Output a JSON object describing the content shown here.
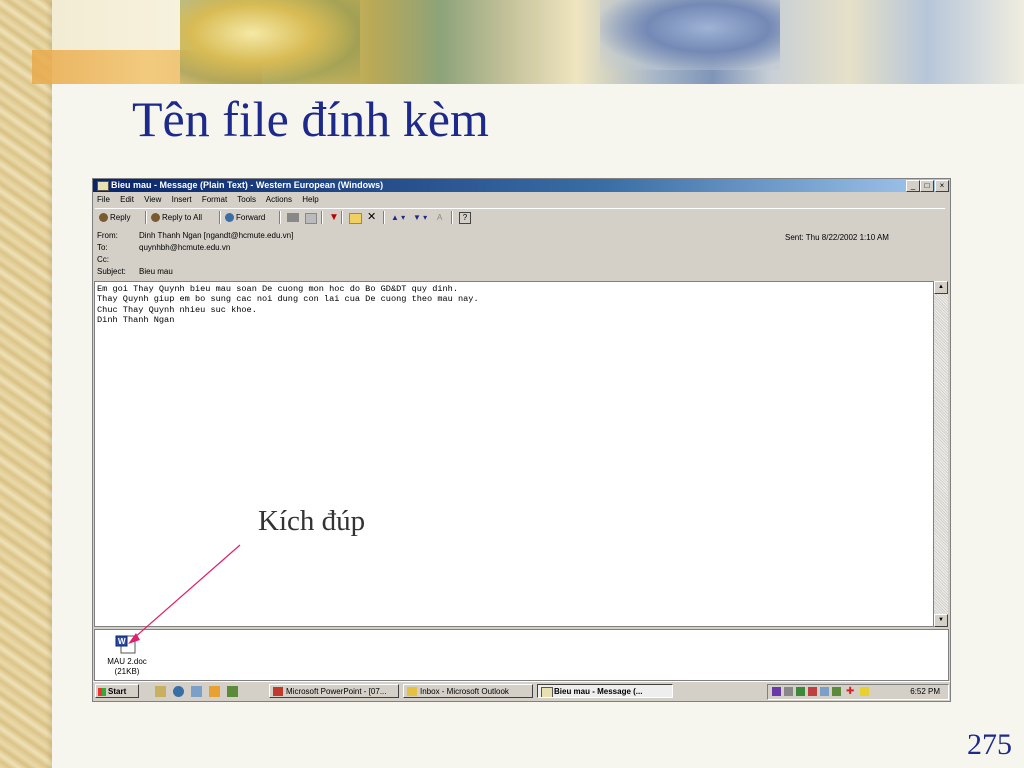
{
  "slide": {
    "title": "Tên file đính kèm",
    "annotation": "Kích đúp",
    "page_number": "275"
  },
  "window": {
    "title": "Bieu mau - Message (Plain Text)  - Western European (Windows)",
    "controls": {
      "minimize": "_",
      "maximize": "□",
      "close": "×"
    },
    "menu": [
      "File",
      "Edit",
      "View",
      "Insert",
      "Format",
      "Tools",
      "Actions",
      "Help"
    ],
    "toolbar": {
      "reply": "Reply",
      "reply_all": "Reply to All",
      "forward": "Forward"
    },
    "headers": {
      "from_label": "From:",
      "from_value": "Dinh Thanh Ngan [ngandt@hcmute.edu.vn]",
      "to_label": "To:",
      "to_value": "quynhbh@hcmute.edu.vn",
      "cc_label": "Cc:",
      "cc_value": "",
      "subject_label": "Subject:",
      "subject_value": "Bieu mau",
      "sent_label": "Sent:",
      "sent_value": "Thu 8/22/2002 1:10 AM"
    },
    "body_lines": [
      "Em goi Thay Quynh bieu mau soan De cuong mon hoc do Bo GD&DT quy dinh.",
      "Thay Quynh giup em bo sung cac noi dung con lai cua De cuong theo mau nay.",
      "Chuc Thay Quynh nhieu suc khoe.",
      "Dinh Thanh Ngan"
    ],
    "attachment": {
      "name": "MAU 2.doc",
      "size": "(21KB)",
      "icon": "word-document-icon"
    }
  },
  "taskbar": {
    "start": "Start",
    "tasks": [
      {
        "label": "Microsoft PowerPoint - [07...",
        "icon": "powerpoint-icon"
      },
      {
        "label": "Inbox - Microsoft Outlook",
        "icon": "outlook-icon"
      },
      {
        "label": "Bieu mau - Message (...",
        "icon": "envelope-icon",
        "active": true
      }
    ],
    "clock": "6:52 PM"
  },
  "colors": {
    "slide_title": "#1d2a8c",
    "titlebar_start": "#0a246a",
    "arrow": "#e0206a"
  }
}
